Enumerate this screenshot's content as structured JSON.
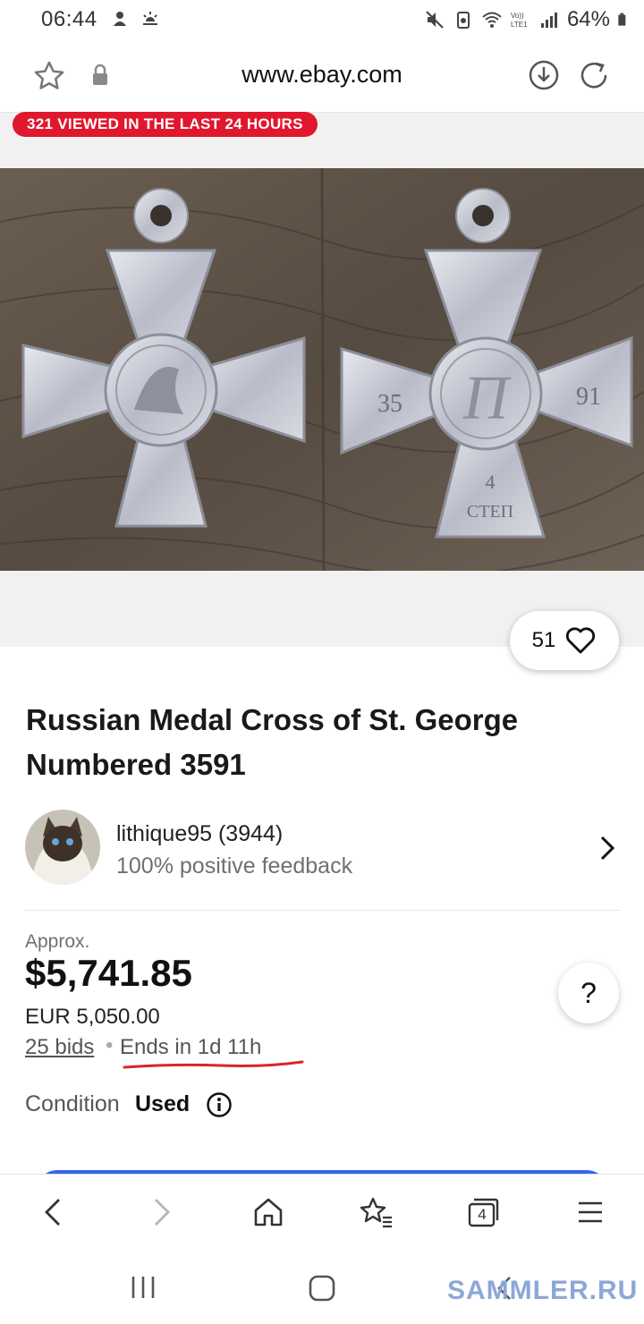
{
  "status_bar": {
    "time": "06:44",
    "battery": "64%"
  },
  "browser": {
    "url": "www.ebay.com",
    "tab_count": "4"
  },
  "banner": {
    "text": "321 VIEWED IN THE LAST 24 HOURS"
  },
  "image_medal": {
    "left_medal_numbers": "35",
    "right_medal_numbers": "91",
    "bottom_marking_line1": "4",
    "bottom_marking_line2": "СТЕП"
  },
  "watch": {
    "count": "51"
  },
  "product": {
    "title": "Russian Medal Cross of St. George Numbered 3591"
  },
  "seller": {
    "name": "lithique95 (3944)",
    "feedback": "100% positive feedback"
  },
  "price": {
    "approx_label": "Approx.",
    "usd": "$5,741.85",
    "eur": "EUR 5,050.00",
    "bids": "25 bids",
    "separator": "•",
    "ends": "Ends in 1d 11h"
  },
  "help": {
    "label": "?"
  },
  "condition": {
    "label": "Condition",
    "value": "Used"
  },
  "watermark": {
    "text": "SAMMLER.RU"
  },
  "colors": {
    "banner_red": "#e0182d",
    "ebay_blue": "#3665f3",
    "annotation_red": "#d9252a"
  }
}
